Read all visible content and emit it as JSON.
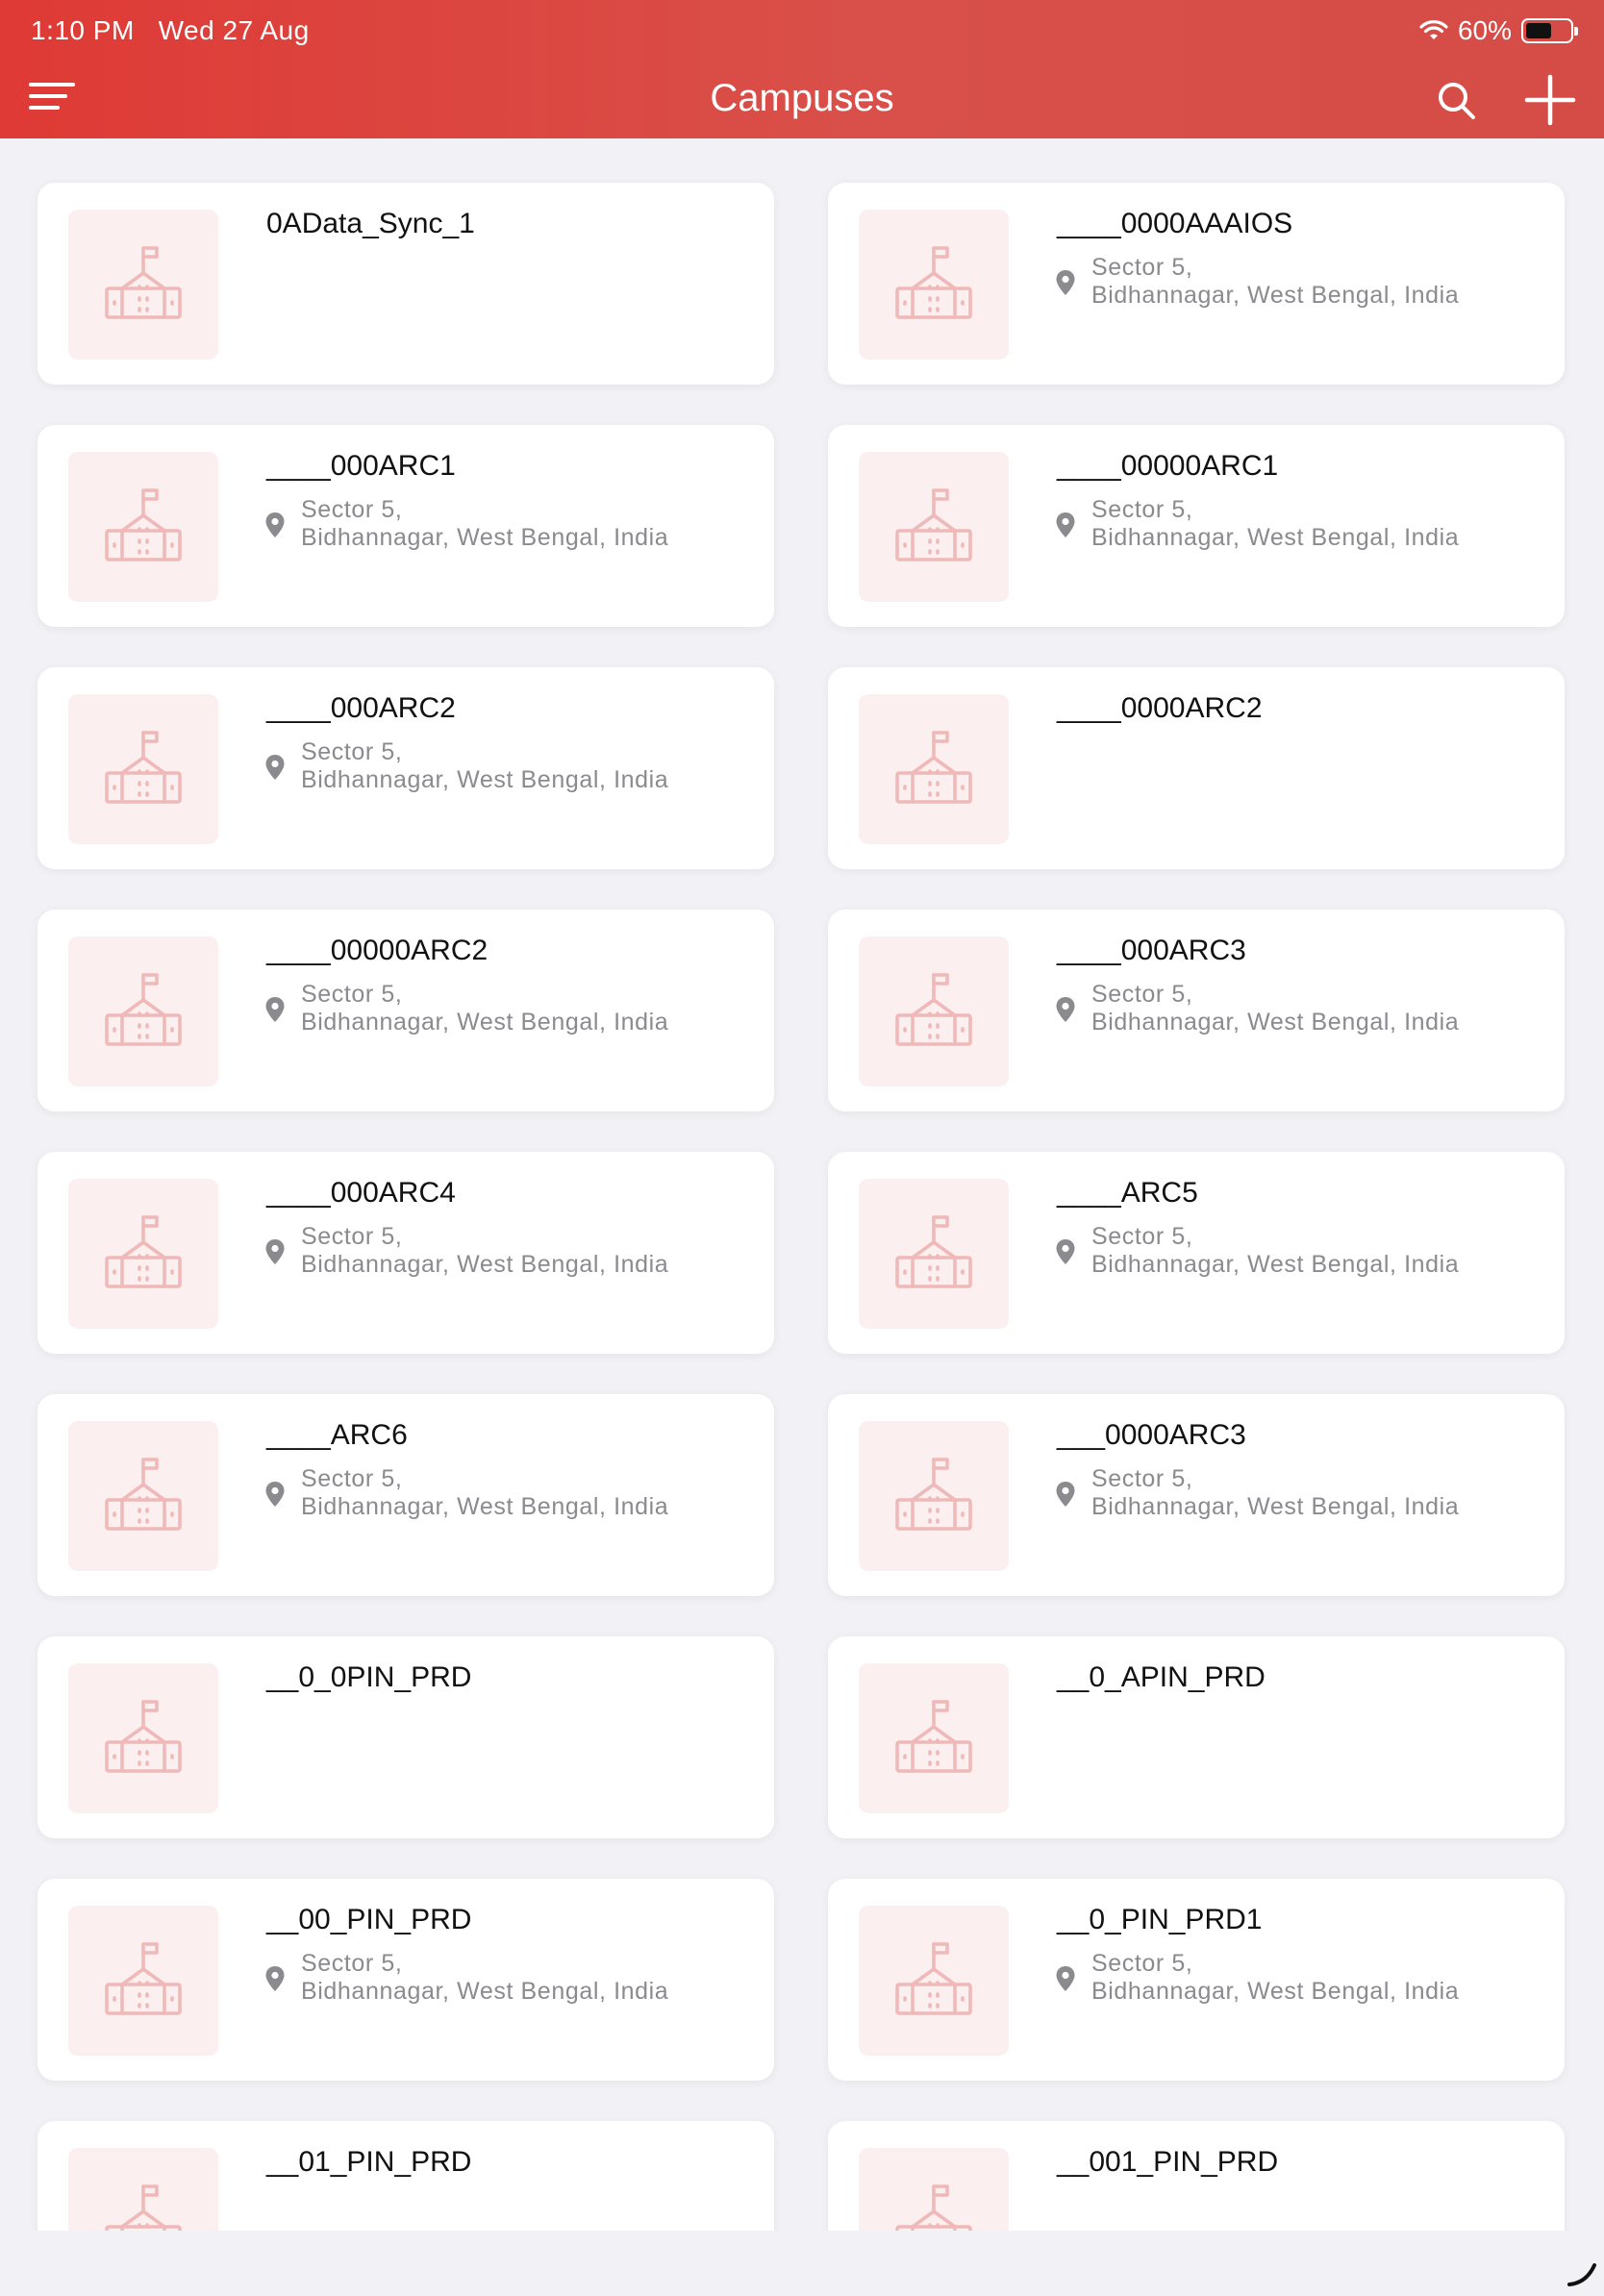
{
  "status_bar": {
    "time": "1:10 PM",
    "date": "Wed 27 Aug",
    "battery": "60%",
    "battery_level": 0.6
  },
  "header": {
    "title": "Campuses",
    "menu_icon": "hamburger-icon",
    "search_icon": "search-icon",
    "add_icon": "plus-icon"
  },
  "campuses": [
    {
      "name": "0AData_Sync_1",
      "address_line1": "",
      "address_line2": ""
    },
    {
      "name": "____0000AAAIOS",
      "address_line1": "Sector 5,",
      "address_line2": "Bidhannagar, West Bengal, India"
    },
    {
      "name": "____000ARC1",
      "address_line1": "Sector 5,",
      "address_line2": "Bidhannagar, West Bengal, India"
    },
    {
      "name": "____00000ARC1",
      "address_line1": "Sector 5,",
      "address_line2": "Bidhannagar, West Bengal, India"
    },
    {
      "name": "____000ARC2",
      "address_line1": "Sector 5,",
      "address_line2": "Bidhannagar, West Bengal, India"
    },
    {
      "name": "____0000ARC2",
      "address_line1": "",
      "address_line2": ""
    },
    {
      "name": "____00000ARC2",
      "address_line1": "Sector 5,",
      "address_line2": "Bidhannagar, West Bengal, India"
    },
    {
      "name": "____000ARC3",
      "address_line1": "Sector 5,",
      "address_line2": "Bidhannagar, West Bengal, India"
    },
    {
      "name": "____000ARC4",
      "address_line1": "Sector 5,",
      "address_line2": "Bidhannagar, West Bengal, India"
    },
    {
      "name": "____ARC5",
      "address_line1": "Sector 5,",
      "address_line2": "Bidhannagar, West Bengal, India"
    },
    {
      "name": "____ARC6",
      "address_line1": "Sector 5,",
      "address_line2": "Bidhannagar, West Bengal, India"
    },
    {
      "name": "___0000ARC3",
      "address_line1": "Sector 5,",
      "address_line2": "Bidhannagar, West Bengal, India"
    },
    {
      "name": "__0_0PIN_PRD",
      "address_line1": "",
      "address_line2": ""
    },
    {
      "name": "__0_APIN_PRD",
      "address_line1": "",
      "address_line2": ""
    },
    {
      "name": "__00_PIN_PRD",
      "address_line1": "Sector 5,",
      "address_line2": "Bidhannagar, West Bengal, India"
    },
    {
      "name": "__0_PIN_PRD1",
      "address_line1": "Sector 5,",
      "address_line2": "Bidhannagar, West Bengal, India"
    },
    {
      "name": "__01_PIN_PRD",
      "address_line1": "",
      "address_line2": ""
    },
    {
      "name": "__001_PIN_PRD",
      "address_line1": "",
      "address_line2": ""
    }
  ],
  "colors": {
    "header_start": "#df3a35",
    "header_end": "#d54b45",
    "icon_tint": "#f0b9b9",
    "thumb_bg": "#fcefef",
    "background": "#f2f2f6"
  }
}
